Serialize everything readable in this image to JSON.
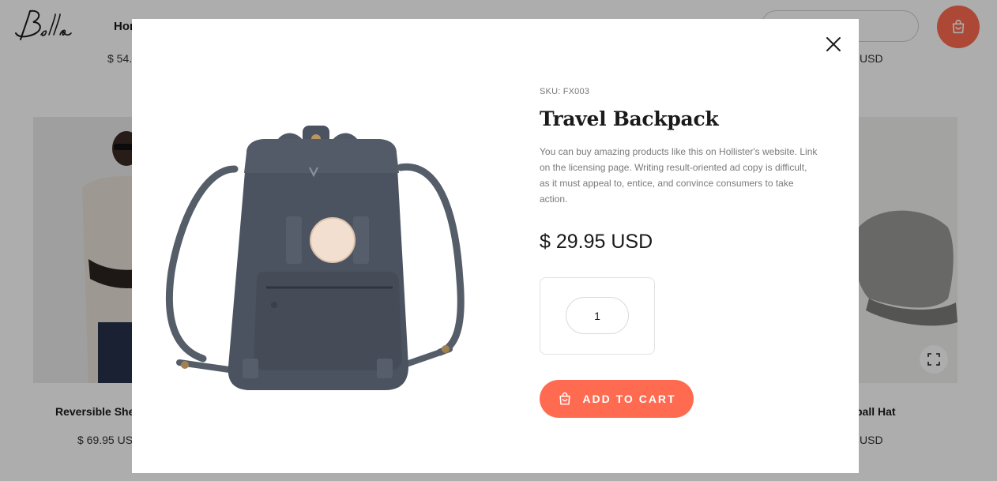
{
  "background": {
    "logo_text": "Bella",
    "nav": {
      "home_label": "Hom"
    },
    "top_prices": {
      "left": "$ 54.",
      "right": "USD"
    },
    "cards": [
      {
        "title": "Reversible She",
        "price": "$ 69.95 USD"
      },
      {
        "title": "ball Hat",
        "price": "USD"
      }
    ]
  },
  "modal": {
    "sku": "SKU: FX003",
    "title": "Travel Backpack",
    "description": "You can buy amazing products like this on Hollister's website. Link on the licensing page. Writing result-oriented ad copy is difficult, as it must appeal to, entice, and convince consumers to take action.",
    "price": "$ 29.95 USD",
    "quantity": "1",
    "add_to_cart_label": "ADD TO CART"
  },
  "colors": {
    "accent": "#ff6b50",
    "overlay": "rgba(0,0,0,0.32)",
    "backpack": "#4b5360"
  },
  "icons": {
    "close": "close-icon",
    "cart": "shopping-bag-icon",
    "expand": "expand-icon"
  }
}
